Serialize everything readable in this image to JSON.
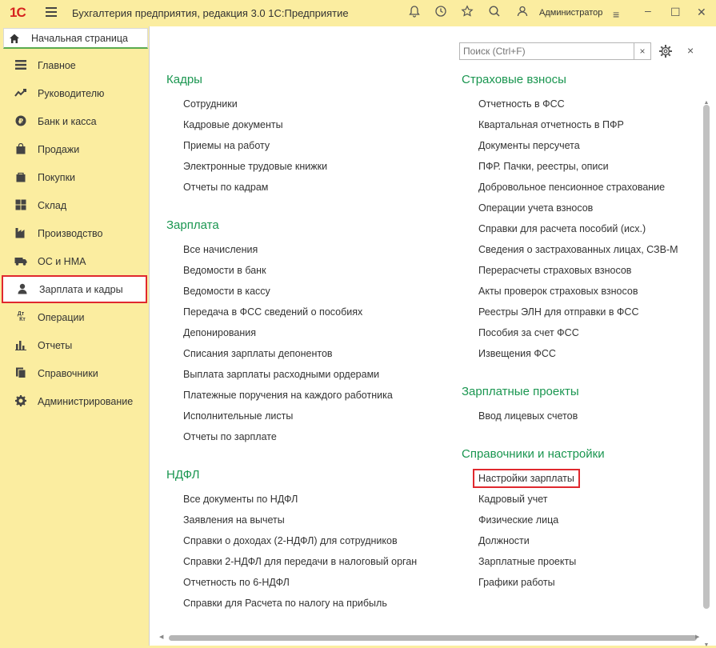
{
  "titlebar": {
    "logo": "1С",
    "title": "Бухгалтерия предприятия, редакция 3.0 1С:Предприятие",
    "user": "Администратор",
    "icons": [
      "bell-icon",
      "history-icon",
      "star-icon",
      "search-icon",
      "user-icon",
      "minimize-icon",
      "maximize-icon",
      "close-icon"
    ]
  },
  "home_tab": {
    "label": "Начальная страница"
  },
  "sidebar": {
    "items": [
      {
        "label": "Главное",
        "icon": "menu-lines-icon"
      },
      {
        "label": "Руководителю",
        "icon": "trend-icon"
      },
      {
        "label": "Банк и касса",
        "icon": "coin-icon"
      },
      {
        "label": "Продажи",
        "icon": "shopping-bag-icon"
      },
      {
        "label": "Покупки",
        "icon": "cart-icon"
      },
      {
        "label": "Склад",
        "icon": "warehouse-icon"
      },
      {
        "label": "Производство",
        "icon": "factory-icon"
      },
      {
        "label": "ОС и НМА",
        "icon": "truck-icon"
      },
      {
        "label": "Зарплата и кадры",
        "icon": "person-icon",
        "active": true
      },
      {
        "label": "Операции",
        "icon": "dt-kt-icon"
      },
      {
        "label": "Отчеты",
        "icon": "bar-chart-icon"
      },
      {
        "label": "Справочники",
        "icon": "books-icon"
      },
      {
        "label": "Администрирование",
        "icon": "gear-icon"
      }
    ]
  },
  "search": {
    "placeholder": "Поиск (Ctrl+F)",
    "clear": "×"
  },
  "close_label": "×",
  "left_column": [
    {
      "title": "Кадры",
      "links": [
        "Сотрудники",
        "Кадровые документы",
        "Приемы на работу",
        "Электронные трудовые книжки",
        "Отчеты по кадрам"
      ]
    },
    {
      "title": "Зарплата",
      "links": [
        "Все начисления",
        "Ведомости в банк",
        "Ведомости в кассу",
        "Передача в ФСС сведений о пособиях",
        "Депонирования",
        "Списания зарплаты депонентов",
        "Выплата зарплаты расходными ордерами",
        "Платежные поручения на каждого работника",
        "Исполнительные листы",
        "Отчеты по зарплате"
      ]
    },
    {
      "title": "НДФЛ",
      "links": [
        "Все документы по НДФЛ",
        "Заявления на вычеты",
        "Справки о доходах (2-НДФЛ) для сотрудников",
        "Справки 2-НДФЛ для передачи в налоговый орган",
        "Отчетность по 6-НДФЛ",
        "Справки для Расчета по налогу на прибыль"
      ]
    }
  ],
  "right_column": [
    {
      "title": "Страховые взносы",
      "links": [
        "Отчетность в ФСС",
        "Квартальная отчетность в ПФР",
        "Документы персучета",
        "ПФР. Пачки, реестры, описи",
        "Добровольное пенсионное страхование",
        "Операции учета взносов",
        "Справки для расчета пособий (исх.)",
        "Сведения о застрахованных лицах, СЗВ-М",
        "Перерасчеты страховых взносов",
        "Акты проверок страховых взносов",
        "Реестры ЭЛН для отправки в ФСС",
        "Пособия за счет ФСС",
        "Извещения ФСС"
      ]
    },
    {
      "title": "Зарплатные проекты",
      "links": [
        "Ввод лицевых счетов"
      ]
    },
    {
      "title": "Справочники и настройки",
      "links": [
        "Настройки зарплаты",
        "Кадровый учет",
        "Физические лица",
        "Должности",
        "Зарплатные проекты",
        "Графики работы"
      ]
    }
  ],
  "colors": {
    "accent_green": "#1a9650",
    "highlight_red": "#e0282e",
    "sidebar_bg": "#fbeda0"
  }
}
